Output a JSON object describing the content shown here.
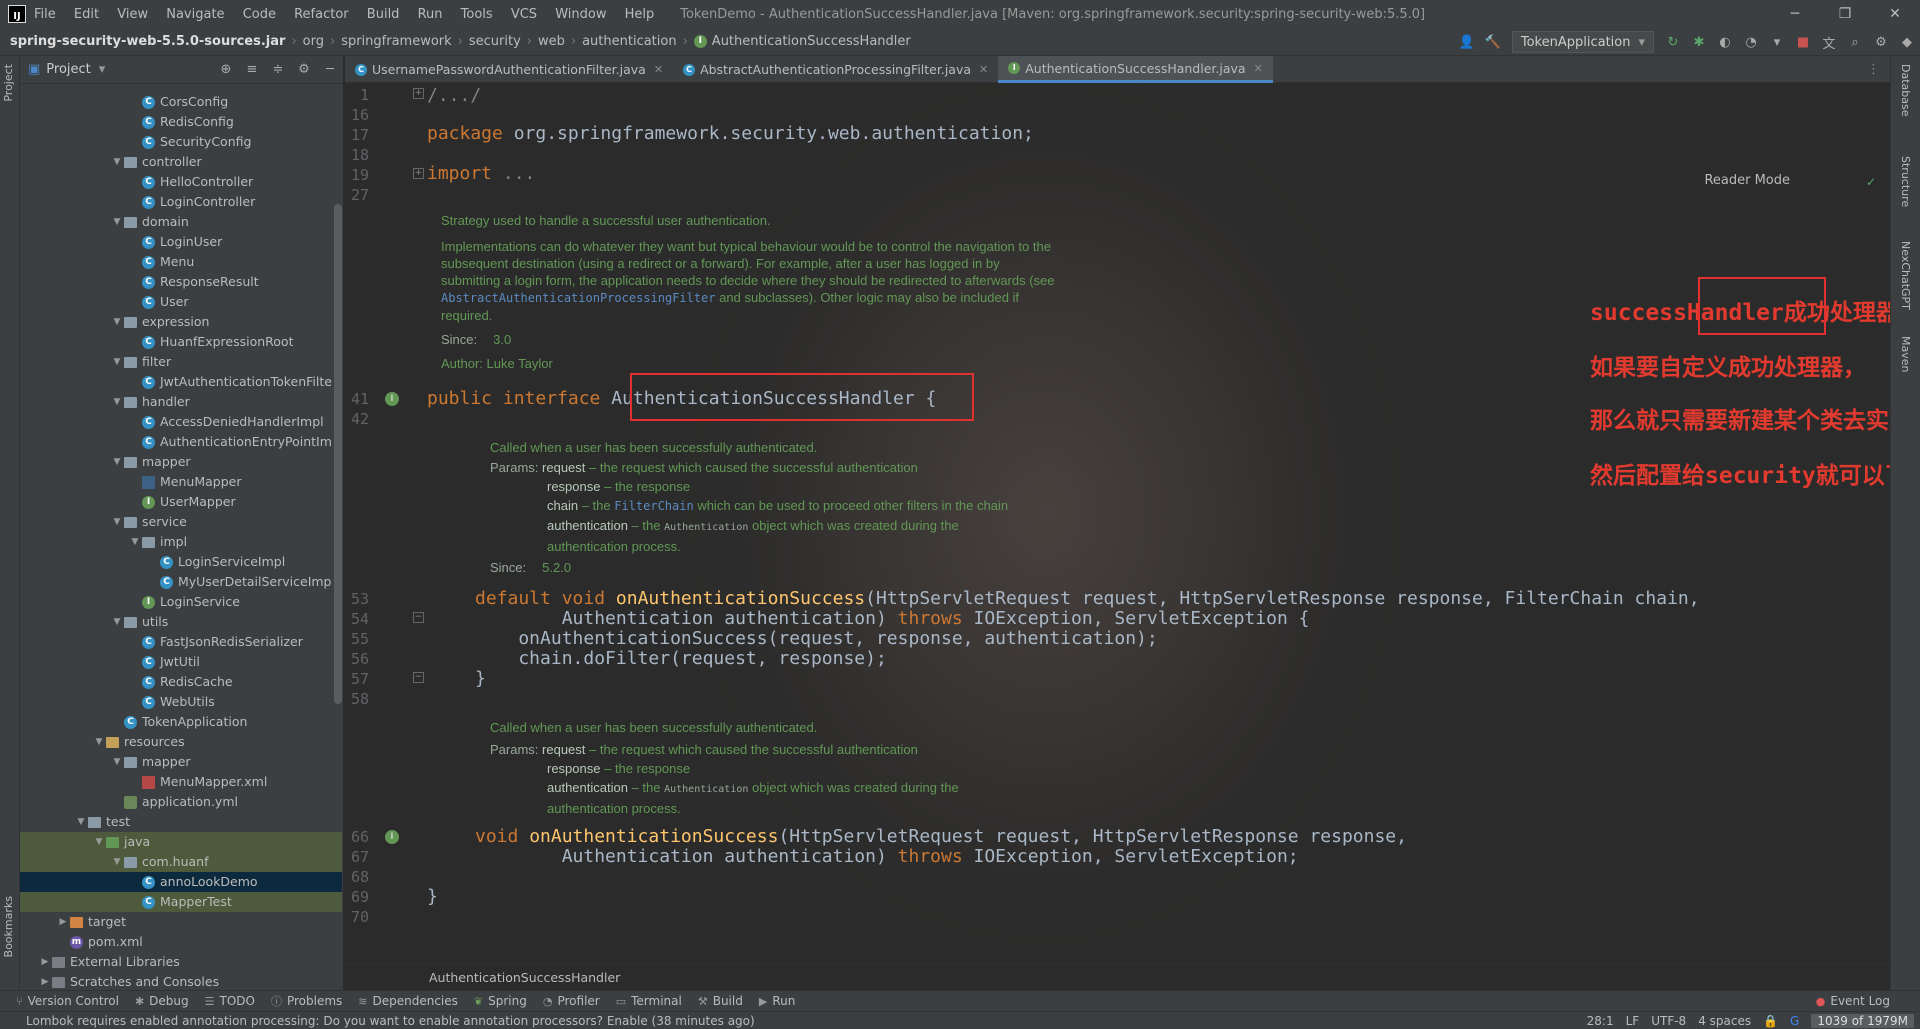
{
  "titlebar": {
    "menu": [
      "File",
      "Edit",
      "View",
      "Navigate",
      "Code",
      "Refactor",
      "Build",
      "Run",
      "Tools",
      "VCS",
      "Window",
      "Help"
    ],
    "title": "TokenDemo - AuthenticationSuccessHandler.java [Maven: org.springframework.security:spring-security-web:5.5.0]"
  },
  "navbar": {
    "breadcrumb": [
      "spring-security-web-5.5.0-sources.jar",
      "org",
      "springframework",
      "security",
      "web",
      "authentication",
      "AuthenticationSuccessHandler"
    ],
    "run_config": "TokenApplication"
  },
  "project": {
    "title": "Project",
    "tree": [
      {
        "label": "CorsConfig",
        "type": "class",
        "indent": 6
      },
      {
        "label": "RedisConfig",
        "type": "class",
        "indent": 6
      },
      {
        "label": "SecurityConfig",
        "type": "class",
        "indent": 6
      },
      {
        "label": "controller",
        "type": "folder",
        "indent": 5,
        "open": true
      },
      {
        "label": "HelloController",
        "type": "class",
        "indent": 6
      },
      {
        "label": "LoginController",
        "type": "class",
        "indent": 6
      },
      {
        "label": "domain",
        "type": "folder",
        "indent": 5,
        "open": true
      },
      {
        "label": "LoginUser",
        "type": "class",
        "indent": 6
      },
      {
        "label": "Menu",
        "type": "class",
        "indent": 6
      },
      {
        "label": "ResponseResult",
        "type": "class",
        "indent": 6
      },
      {
        "label": "User",
        "type": "class",
        "indent": 6
      },
      {
        "label": "expression",
        "type": "folder",
        "indent": 5,
        "open": true
      },
      {
        "label": "HuanfExpressionRoot",
        "type": "class",
        "indent": 6
      },
      {
        "label": "filter",
        "type": "folder",
        "indent": 5,
        "open": true
      },
      {
        "label": "JwtAuthenticationTokenFilte",
        "type": "class",
        "indent": 6
      },
      {
        "label": "handler",
        "type": "folder",
        "indent": 5,
        "open": true
      },
      {
        "label": "AccessDeniedHandlerImpl",
        "type": "class",
        "indent": 6
      },
      {
        "label": "AuthenticationEntryPointIm",
        "type": "class",
        "indent": 6
      },
      {
        "label": "mapper",
        "type": "folder",
        "indent": 5,
        "open": true
      },
      {
        "label": "MenuMapper",
        "type": "mapper",
        "indent": 6
      },
      {
        "label": "UserMapper",
        "type": "interface",
        "indent": 6
      },
      {
        "label": "service",
        "type": "folder",
        "indent": 5,
        "open": true
      },
      {
        "label": "impl",
        "type": "folder",
        "indent": 6,
        "open": true
      },
      {
        "label": "LoginServiceImpl",
        "type": "class",
        "indent": 7
      },
      {
        "label": "MyUserDetailServiceImp",
        "type": "class",
        "indent": 7
      },
      {
        "label": "LoginService",
        "type": "interface",
        "indent": 6
      },
      {
        "label": "utils",
        "type": "folder",
        "indent": 5,
        "open": true
      },
      {
        "label": "FastJsonRedisSerializer",
        "type": "class",
        "indent": 6
      },
      {
        "label": "JwtUtil",
        "type": "class",
        "indent": 6
      },
      {
        "label": "RedisCache",
        "type": "class",
        "indent": 6
      },
      {
        "label": "WebUtils",
        "type": "class",
        "indent": 6
      },
      {
        "label": "TokenApplication",
        "type": "class",
        "indent": 5
      },
      {
        "label": "resources",
        "type": "resfolder",
        "indent": 4,
        "open": true
      },
      {
        "label": "mapper",
        "type": "folder",
        "indent": 5,
        "open": true
      },
      {
        "label": "MenuMapper.xml",
        "type": "xml",
        "indent": 6
      },
      {
        "label": "application.yml",
        "type": "yml",
        "indent": 5
      },
      {
        "label": "test",
        "type": "folder",
        "indent": 3,
        "open": true
      },
      {
        "label": "java",
        "type": "testfolder",
        "indent": 4,
        "open": true,
        "hl": "test"
      },
      {
        "label": "com.huanf",
        "type": "folder",
        "indent": 5,
        "open": true,
        "hl": "test"
      },
      {
        "label": "annoLookDemo",
        "type": "class",
        "indent": 6,
        "hl": "sel"
      },
      {
        "label": "MapperTest",
        "type": "class",
        "indent": 6,
        "hl": "test"
      },
      {
        "label": "target",
        "type": "target",
        "indent": 2,
        "open": false
      },
      {
        "label": "pom.xml",
        "type": "pom",
        "indent": 2
      },
      {
        "label": "External Libraries",
        "type": "lib",
        "indent": 1,
        "open": false
      },
      {
        "label": "Scratches and Consoles",
        "type": "lib",
        "indent": 1,
        "open": false
      }
    ]
  },
  "tabs": [
    {
      "label": "UsernamePasswordAuthenticationFilter.java",
      "active": false
    },
    {
      "label": "AbstractAuthenticationProcessingFilter.java",
      "active": false
    },
    {
      "label": "AuthenticationSuccessHandler.java",
      "active": true
    }
  ],
  "editor": {
    "reader_mode": "Reader Mode",
    "line_numbers": [
      "1",
      "16",
      "17",
      "18",
      "19",
      "27",
      "41",
      "42",
      "53",
      "54",
      "55",
      "56",
      "57",
      "58",
      "66",
      "67",
      "68",
      "69",
      "70"
    ],
    "code": {
      "l1": "/.../",
      "package_kw": "package",
      "package_name": " org.springframework.security.web.authentication;",
      "import_kw": "import",
      "import_rest": " ...",
      "iface_kw": "public interface ",
      "iface_name": "AuthenticationSuccessHandler",
      "iface_brace": " {",
      "m1_kw": "default void ",
      "m1_name": "onAuthenticationSuccess",
      "m1_params": "(HttpServletRequest request, HttpServletResponse response, FilterChain chain,",
      "m1_cont": "        Authentication authentication) ",
      "throws_kw": "throws",
      "m1_ex": " IOException, ServletException {",
      "m1_body1": "    onAuthenticationSuccess(request, response, authentication);",
      "m1_body2": "    chain.doFilter(request, response);",
      "close1": "}",
      "m2_kw": "void ",
      "m2_name": "onAuthenticationSuccess",
      "m2_params": "(HttpServletRequest request, HttpServletResponse response,",
      "m2_cont": "        Authentication authentication) ",
      "m2_ex": " IOException, ServletException;",
      "close2": "}"
    },
    "doc1": {
      "line1": "Strategy used to handle a successful user authentication.",
      "para_a": "Implementations can do whatever they want but typical behaviour would be to control the navigation to the subsequent destination (using a redirect or a forward). For example, after a user has logged in by submitting a login form, the application needs to decide where they should be redirected to afterwards (see ",
      "link": "AbstractAuthenticationProcessingFilter",
      "para_b": " and subclasses). Other logic may also be included if required.",
      "since_label": "Since:",
      "since_val": "3.0",
      "author": "Author: Luke Taylor"
    },
    "doc2": {
      "summary": "Called when a user has been successfully authenticated.",
      "params_label": "Params:",
      "p1_name": "request",
      "p1_desc": " – the request which caused the successful authentication",
      "p2_name": "response",
      "p2_desc": " – the response",
      "p3_name": "chain",
      "p3_a": " – the ",
      "p3_link": "FilterChain",
      "p3_b": " which can be used to proceed other filters in the chain",
      "p4_name": "authentication",
      "p4_a": " – the ",
      "p4_mono": "Authentication",
      "p4_b": " object which was created during the",
      "p4_c": "authentication process.",
      "since_label": "Since:",
      "since_val": "5.2.0"
    },
    "doc3": {
      "summary": "Called when a user has been successfully authenticated.",
      "params_label": "Params:",
      "p1_name": "request",
      "p1_desc": " – the request which caused the successful authentication",
      "p2_name": "response",
      "p2_desc": " – the response",
      "p4_name": "authentication",
      "p4_a": " – the ",
      "p4_mono": "Authentication",
      "p4_b": " object which was created during the",
      "p4_c": "authentication process."
    },
    "annotations": [
      "successHandler成功处理器的类型是一个接口",
      "如果要自定义成功处理器，",
      "那么就只需要新建某个类去实现这个接口，",
      "然后配置给security就可以了"
    ],
    "bottom_crumb": "AuthenticationSuccessHandler"
  },
  "right_strip": [
    "Database",
    "Structure",
    "NexChatGPT",
    "Maven"
  ],
  "left_strip": [
    "Project",
    "Bookmarks"
  ],
  "toolwindows": [
    "Version Control",
    "Debug",
    "TODO",
    "Problems",
    "Dependencies",
    "Spring",
    "Profiler",
    "Terminal",
    "Build",
    "Run"
  ],
  "event_log": "Event Log",
  "status": {
    "message": "Lombok requires enabled annotation processing: Do you want to enable annotation processors? Enable (38 minutes ago)",
    "position": "28:1",
    "line_sep": "LF",
    "encoding": "UTF-8",
    "indent": "4 spaces",
    "memory": "1039 of 1979M"
  },
  "colors": {
    "keyword": "#cc7832",
    "function": "#ffc66d",
    "doc": "#629755",
    "annotation": "#e23a2f",
    "accent": "#4a88c7"
  }
}
